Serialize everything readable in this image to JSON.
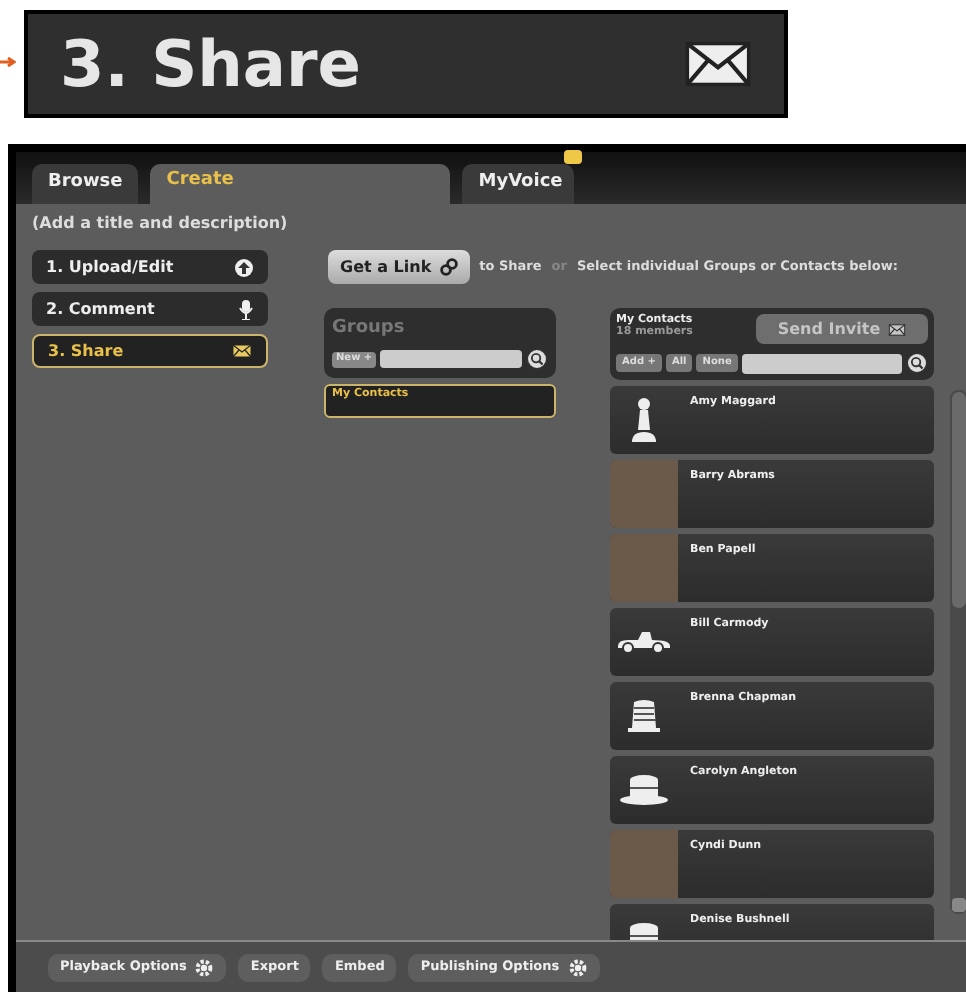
{
  "banner": {
    "title": "3. Share"
  },
  "tabs": [
    {
      "label": "Browse",
      "selected": false
    },
    {
      "label": "Create",
      "selected": true
    },
    {
      "label": "MyVoice",
      "selected": false,
      "notification": true
    }
  ],
  "hint": "(Add a title and description)",
  "steps": [
    {
      "label": "1. Upload/Edit",
      "kind": "upload",
      "selected": false
    },
    {
      "label": "2. Comment",
      "kind": "mic",
      "selected": false
    },
    {
      "label": "3. Share",
      "kind": "mail",
      "selected": true
    }
  ],
  "share_bar": {
    "button": "Get a Link",
    "text": "to Share",
    "or": "or",
    "rest": "Select individual Groups or Contacts below:"
  },
  "groups": {
    "title": "Groups",
    "new_button": "New +",
    "items": [
      {
        "label": "My Contacts",
        "selected": true
      }
    ]
  },
  "contacts": {
    "title": "My Contacts",
    "count": "18 members",
    "send_button": "Send Invite",
    "send_disabled": true,
    "add_button": "Add +",
    "all_button": "All",
    "none_button": "None",
    "items": [
      {
        "name": "Amy Maggard",
        "kind": "pawn"
      },
      {
        "name": "Barry Abrams",
        "kind": "photo"
      },
      {
        "name": "Ben Papell",
        "kind": "photo"
      },
      {
        "name": "Bill Carmody",
        "kind": "car"
      },
      {
        "name": "Brenna Chapman",
        "kind": "thimble"
      },
      {
        "name": "Carolyn Angleton",
        "kind": "hat"
      },
      {
        "name": "Cyndi Dunn",
        "kind": "photo"
      },
      {
        "name": "Denise Bushnell",
        "kind": "hat"
      }
    ]
  },
  "footer": [
    {
      "label": "Playback Options",
      "gear": true
    },
    {
      "label": "Export",
      "gear": false
    },
    {
      "label": "Embed",
      "gear": false
    },
    {
      "label": "Publishing Options",
      "gear": true
    }
  ]
}
